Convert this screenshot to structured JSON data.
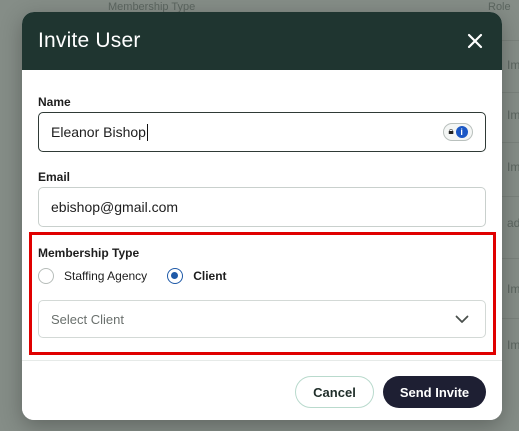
{
  "background": {
    "column_headers": [
      "Membership Type",
      "Role"
    ],
    "row_fragments": [
      "Imi",
      "Imi",
      "Imi",
      "ad",
      "Imi",
      "Imi"
    ]
  },
  "modal": {
    "title": "Invite User",
    "close_icon": "close-icon",
    "name": {
      "label": "Name",
      "value": "Eleanor Bishop"
    },
    "email": {
      "label": "Email",
      "value": "ebishop@gmail.com"
    },
    "membership": {
      "label": "Membership Type",
      "options": [
        {
          "label": "Staffing Agency",
          "selected": false
        },
        {
          "label": "Client",
          "selected": true
        }
      ]
    },
    "client_select": {
      "placeholder": "Select Client",
      "icon": "chevron-down-icon"
    },
    "footer": {
      "cancel_label": "Cancel",
      "send_label": "Send Invite"
    }
  },
  "colors": {
    "header_bg": "#1f3530",
    "radio_selected": "#1f5aa8",
    "send_button": "#1e1f33",
    "highlight": "#e00000"
  }
}
